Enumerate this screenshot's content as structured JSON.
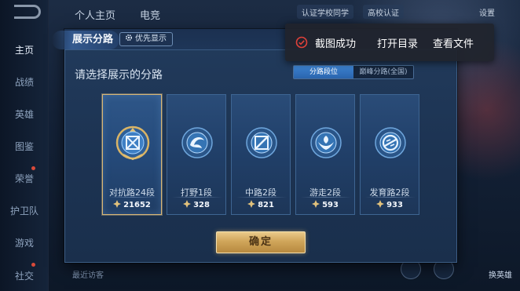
{
  "background": {
    "tabs": [
      "个人主页",
      "电竞"
    ],
    "top_right": {
      "school_link": "认证学校同学",
      "school_badge": "高校认证",
      "settings": "设置"
    },
    "sidebar": [
      {
        "label": "主页",
        "active": true
      },
      {
        "label": "战绩",
        "active": false
      },
      {
        "label": "英雄",
        "active": false
      },
      {
        "label": "图鉴",
        "active": false
      },
      {
        "label": "荣誉",
        "active": false
      },
      {
        "label": "护卫队",
        "active": false
      },
      {
        "label": "游戏",
        "active": false
      },
      {
        "label": "社交",
        "active": false
      }
    ],
    "bottom_text": "最近访客",
    "bottom_right_label": "换英雄"
  },
  "dialog": {
    "title": "展示分路",
    "priority_chip": "优先显示",
    "prompt": "请选择展示的分路",
    "segment": {
      "options": [
        {
          "label": "分路段位",
          "active": true
        },
        {
          "label": "巅峰分路(全国)",
          "active": false
        }
      ]
    },
    "cards": [
      {
        "name": "对抗路24段",
        "score": "21652",
        "icon": "clash-lane-emblem-icon",
        "selected": true
      },
      {
        "name": "打野1段",
        "score": "328",
        "icon": "jungle-emblem-icon",
        "selected": false
      },
      {
        "name": "中路2段",
        "score": "821",
        "icon": "mid-lane-emblem-icon",
        "selected": false
      },
      {
        "name": "游走2段",
        "score": "593",
        "icon": "roam-emblem-icon",
        "selected": false
      },
      {
        "name": "发育路2段",
        "score": "933",
        "icon": "farm-lane-emblem-icon",
        "selected": false
      }
    ],
    "confirm_label": "确定"
  },
  "toast": {
    "message": "截图成功",
    "open_folder": "打开目录",
    "view_file": "查看文件"
  },
  "colors": {
    "accent_gold": "#d8b777",
    "segment_active": "#2f6fbf",
    "toast_icon": "#e0413a"
  }
}
